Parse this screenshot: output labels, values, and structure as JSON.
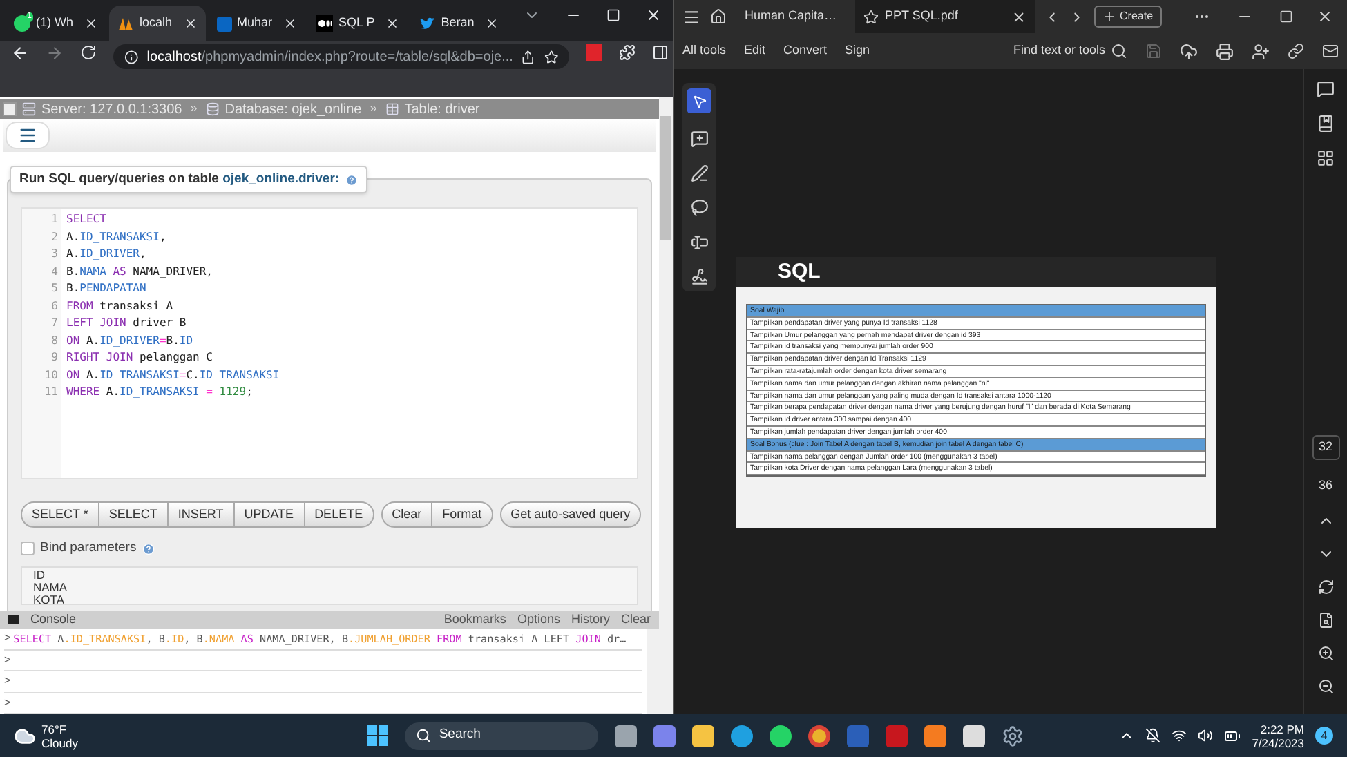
{
  "browser": {
    "tabs": [
      {
        "kind": "whatsapp",
        "title": "(1) Wh",
        "badge": "1",
        "selected": false
      },
      {
        "kind": "pma",
        "title": "localh",
        "selected": true
      },
      {
        "kind": "linkedin",
        "title": "Muhar",
        "selected": false
      },
      {
        "kind": "medium",
        "title": "SQL P",
        "selected": false
      },
      {
        "kind": "twitter",
        "title": "Beran",
        "selected": false
      }
    ],
    "url_host": "localhost",
    "url_path": "/phpmyadmin/index.php?route=/table/sql&db=oje..."
  },
  "breadcrumb": [
    {
      "kind": "server",
      "text": "Server: 127.0.0.1:3306"
    },
    {
      "kind": "database",
      "text": "Database: ojek_online"
    },
    {
      "kind": "table",
      "text": "Table: driver"
    }
  ],
  "breadcrumb_separator": "»",
  "query_panel": {
    "legend_prefix": "Run SQL query/queries on table ",
    "legend_table": "ojek_online.driver:",
    "code_lines": [
      {
        "number": "1",
        "tokens": [
          {
            "kind": "keyword",
            "text": "SELECT"
          }
        ]
      },
      {
        "number": "2",
        "tokens": [
          {
            "kind": "plain",
            "text": "A."
          },
          {
            "kind": "variable",
            "text": "ID_TRANSAKSI"
          },
          {
            "kind": "plain",
            "text": ","
          }
        ]
      },
      {
        "number": "3",
        "tokens": [
          {
            "kind": "plain",
            "text": "A."
          },
          {
            "kind": "variable",
            "text": "ID_DRIVER"
          },
          {
            "kind": "plain",
            "text": ","
          }
        ]
      },
      {
        "number": "4",
        "tokens": [
          {
            "kind": "plain",
            "text": "B."
          },
          {
            "kind": "variable",
            "text": "NAMA"
          },
          {
            "kind": "keyword",
            "text": " AS"
          },
          {
            "kind": "plain",
            "text": " NAMA_DRIVER,"
          }
        ]
      },
      {
        "number": "5",
        "tokens": [
          {
            "kind": "plain",
            "text": "B."
          },
          {
            "kind": "variable",
            "text": "PENDAPATAN"
          }
        ]
      },
      {
        "number": "6",
        "tokens": [
          {
            "kind": "keyword",
            "text": "FROM"
          },
          {
            "kind": "plain",
            "text": " transaksi A"
          }
        ]
      },
      {
        "number": "7",
        "tokens": [
          {
            "kind": "keyword",
            "text": "LEFT JOIN"
          },
          {
            "kind": "plain",
            "text": " driver B"
          }
        ]
      },
      {
        "number": "8",
        "tokens": [
          {
            "kind": "keyword",
            "text": "ON"
          },
          {
            "kind": "plain",
            "text": " A."
          },
          {
            "kind": "variable",
            "text": "ID_DRIVER"
          },
          {
            "kind": "operator",
            "text": "="
          },
          {
            "kind": "plain",
            "text": "B."
          },
          {
            "kind": "variable",
            "text": "ID"
          }
        ]
      },
      {
        "number": "9",
        "tokens": [
          {
            "kind": "keyword",
            "text": "RIGHT JOIN"
          },
          {
            "kind": "plain",
            "text": " pelanggan C"
          }
        ]
      },
      {
        "number": "10",
        "tokens": [
          {
            "kind": "keyword",
            "text": "ON"
          },
          {
            "kind": "plain",
            "text": " A."
          },
          {
            "kind": "variable",
            "text": "ID_TRANSAKSI"
          },
          {
            "kind": "operator",
            "text": "="
          },
          {
            "kind": "plain",
            "text": "C."
          },
          {
            "kind": "variable",
            "text": "ID_TRANSAKSI"
          }
        ]
      },
      {
        "number": "11",
        "tokens": [
          {
            "kind": "keyword",
            "text": "WHERE"
          },
          {
            "kind": "plain",
            "text": " A."
          },
          {
            "kind": "variable",
            "text": "ID_TRANSAKSI"
          },
          {
            "kind": "operator",
            "text": " = "
          },
          {
            "kind": "number",
            "text": "1129"
          },
          {
            "kind": "plain",
            "text": ";"
          }
        ]
      }
    ],
    "button_groups": [
      [
        "SELECT *",
        "SELECT",
        "INSERT",
        "UPDATE",
        "DELETE"
      ],
      [
        "Clear",
        "Format"
      ],
      [
        "Get auto-saved query"
      ]
    ],
    "bind_parameters": {
      "label": "Bind parameters",
      "checked": false
    },
    "columns": [
      "ID",
      "NAMA",
      "KOTA"
    ]
  },
  "console": {
    "title": "Console",
    "links": [
      "Bookmarks",
      "Options",
      "History",
      "Clear"
    ],
    "lines": [
      {
        "prompt": ">",
        "tokens": [
          {
            "kind": "keyword",
            "text": "SELECT"
          },
          {
            "kind": "plain",
            "text": " A"
          },
          {
            "kind": "field",
            "text": ".ID_TRANSAKSI"
          },
          {
            "kind": "plain",
            "text": ", B"
          },
          {
            "kind": "field",
            "text": ".ID"
          },
          {
            "kind": "plain",
            "text": ", B"
          },
          {
            "kind": "field",
            "text": ".NAMA"
          },
          {
            "kind": "keyword",
            "text": " AS"
          },
          {
            "kind": "plain",
            "text": " NAMA_DRIVER, B"
          },
          {
            "kind": "field",
            "text": ".JUMLAH_ORDER"
          },
          {
            "kind": "keyword",
            "text": " FROM"
          },
          {
            "kind": "plain",
            "text": " transaksi A LEFT"
          },
          {
            "kind": "keyword",
            "text": " JOIN"
          },
          {
            "kind": "plain",
            "text": " dr…"
          }
        ]
      },
      {
        "prompt": ">"
      },
      {
        "prompt": ">"
      },
      {
        "prompt": ">"
      }
    ]
  },
  "acrobat": {
    "tabs": [
      {
        "title": "Human Capita…",
        "selected": false
      },
      {
        "title": "PPT SQL.pdf",
        "selected": true
      }
    ],
    "create_label": "Create",
    "menu": [
      "All tools",
      "Edit",
      "Convert",
      "Sign"
    ],
    "search_label": "Find text or tools",
    "page_numbers": [
      "32",
      "36"
    ],
    "slide": {
      "title": "SQL",
      "rows": [
        {
          "kind": "header",
          "text": "Soal Wajib"
        },
        {
          "kind": "row",
          "text": "Tampilkan pendapatan driver  yang punya Id transaksi 1128"
        },
        {
          "kind": "row",
          "text": "Tampilkan  Umur pelanggan yang pernah mendapat driver dengan id 393"
        },
        {
          "kind": "row",
          "text": "Tampilkan id transaksi yang mempunyai jumlah order 900"
        },
        {
          "kind": "row",
          "text": "Tampilkan pendapatan driver dengan Id Transaksi 1129"
        },
        {
          "kind": "row",
          "text": "Tampilkan rata-ratajumlah order dengan kota driver semarang"
        },
        {
          "kind": "row",
          "text": "Tampilkan nama dan  umur pelanggan dengan akhiran nama pelanggan \"ni\""
        },
        {
          "kind": "row",
          "text": "Tampilkan nama dan umur pelanggan yang paling muda dengan Id transaksi antara 1000-1120"
        },
        {
          "kind": "row",
          "text": "Tampilkan berapa pendapatan driver dengan nama driver yang berujung dengan huruf \"I\" dan berada di Kota Semarang"
        },
        {
          "kind": "row",
          "text": "Tampilkan id driver antara 300 sampai dengan 400"
        },
        {
          "kind": "row",
          "text": "Tampilkan jumlah pendapatan driver dengan jumlah order 400"
        },
        {
          "kind": "header",
          "text": "Soal Bonus (clue : Join Tabel A dengan tabel B, kemudian join tabel A dengan tabel C)"
        },
        {
          "kind": "row",
          "text": "Tampilkan nama pelanggan dengan Jumlah order 100 (menggunakan 3 tabel)"
        },
        {
          "kind": "row",
          "text": "Tampilkan kota Driver dengan nama pelanggan Lara (menggunakan 3 tabel)"
        }
      ]
    }
  },
  "taskbar": {
    "temperature": "76°F",
    "weather": "Cloudy",
    "search": "Search",
    "time": "2:22 PM",
    "date": "7/24/2023",
    "notifications": "4"
  }
}
